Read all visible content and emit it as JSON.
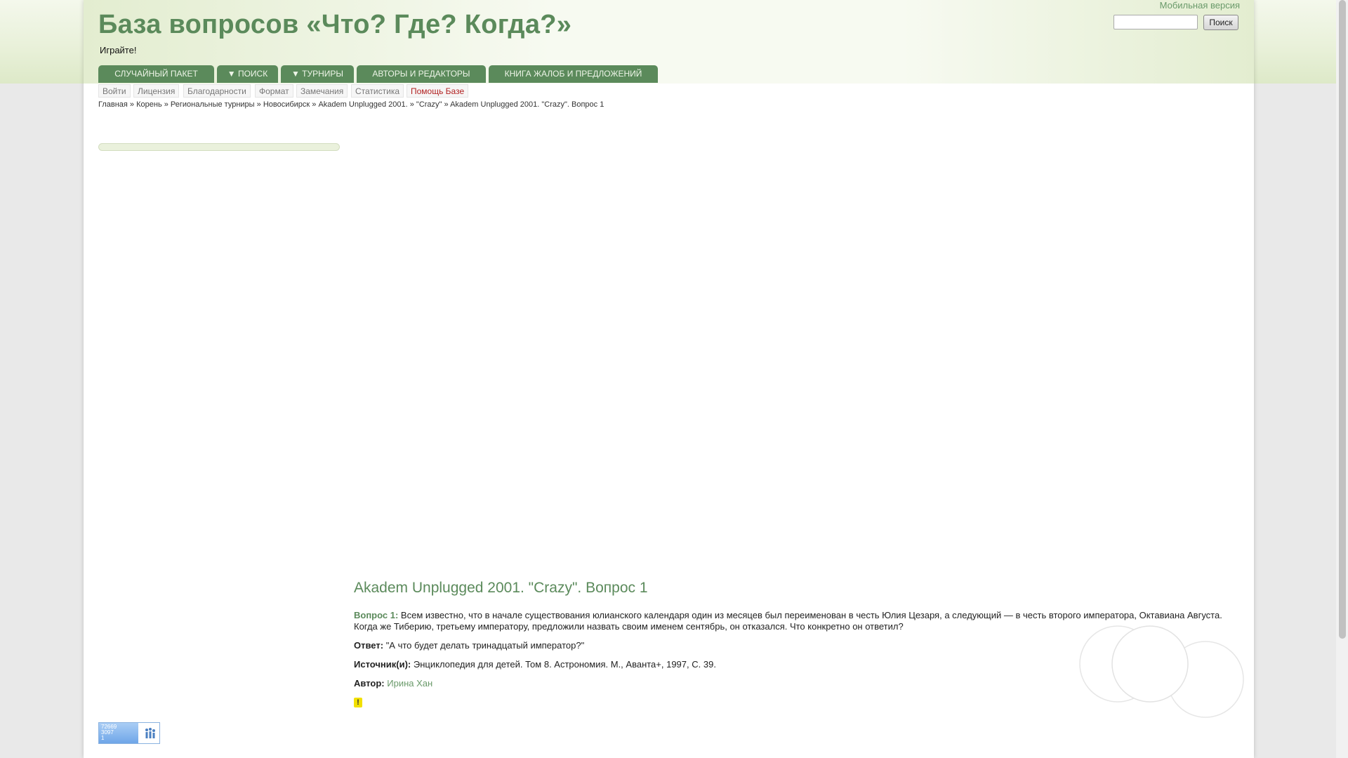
{
  "header": {
    "site_title": "База вопросов «Что? Где? Когда?»",
    "tagline": "Играйте!",
    "mobile_link": "Мобильная версия",
    "search_placeholder": "",
    "search_button": "Поиск"
  },
  "nav_tabs": [
    {
      "label": "СЛУЧАЙНЫЙ ПАКЕТ"
    },
    {
      "label": "▼ ПОИСК"
    },
    {
      "label": "▼ ТУРНИРЫ"
    },
    {
      "label": "АВТОРЫ И РЕДАКТОРЫ"
    },
    {
      "label": "КНИГА ЖАЛОБ И ПРЕДЛОЖЕНИЙ"
    }
  ],
  "sub_nav": [
    {
      "label": "Войти"
    },
    {
      "label": "Лицензия"
    },
    {
      "label": "Благодарности"
    },
    {
      "label": "Формат"
    },
    {
      "label": "Замечания"
    },
    {
      "label": "Статистика"
    },
    {
      "label": "Помощь Базе"
    }
  ],
  "breadcrumb": {
    "items": [
      "Главная",
      "Корень",
      "Региональные турниры",
      "Новосибирск",
      "Akadem Unplugged 2001.",
      "\"Crazy\"",
      "Akadem Unplugged 2001. \"Crazy\". Вопрос 1"
    ],
    "separator": " » "
  },
  "question": {
    "title": "Akadem Unplugged 2001. \"Crazy\". Вопрос 1",
    "label": "Вопрос 1:",
    "text": "Всем известно, что в начале существования юлианского календаря один из месяцев был переименован в честь Юлия Цезаря, а следующий — в честь второго императора, Октавиана Августа. Когда же Тиберию, третьему императору, предложили назвать своим именем сентябрь, он отказался. Что конкретно он ответил?",
    "answer_label": "Ответ:",
    "answer": "\"А что будет делать тринадцатый император?\"",
    "sources_label": "Источник(и):",
    "sources": "Энциклопедия для детей. Том 8. Астрономия. М., Аванта+, 1997, С. 39.",
    "author_label": "Автор:",
    "author": "Ирина Хан",
    "flag": "!"
  },
  "counter": {
    "line1": "72669",
    "line2": "3097",
    "line3": "1"
  },
  "colors": {
    "accent_green": "#5b8a5b",
    "flag_yellow": "#f2e000",
    "help_red": "#b22222"
  }
}
